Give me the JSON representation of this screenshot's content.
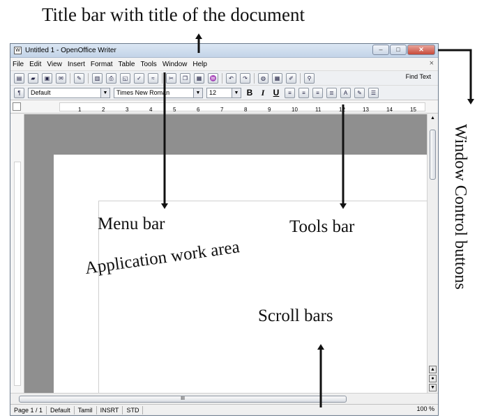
{
  "annotations": {
    "title_bar": "Title bar with title of the document",
    "menu_bar": "Menu bar",
    "tools_bar": "Tools bar",
    "work_area": "Application work area",
    "scroll_bars": "Scroll bars",
    "window_controls": "Window Control buttons"
  },
  "window": {
    "title": "Untitled 1 - OpenOffice Writer",
    "controls": [
      "–",
      "□",
      "✕"
    ]
  },
  "menu": {
    "items": [
      "File",
      "Edit",
      "View",
      "Insert",
      "Format",
      "Table",
      "Tools",
      "Window",
      "Help"
    ],
    "close_glyph": "×"
  },
  "toolbar": {
    "find_label": "Find Text"
  },
  "formatting": {
    "style": "Default",
    "font": "Times New Roman",
    "size": "12",
    "bold": "B",
    "italic": "I",
    "underline": "U"
  },
  "ruler": {
    "marks": [
      "1",
      "2",
      "3",
      "4",
      "5",
      "6",
      "7",
      "8",
      "9",
      "10",
      "11",
      "12",
      "13",
      "14",
      "15"
    ]
  },
  "status": {
    "page": "Page 1 / 1",
    "style": "Default",
    "language": "Tamil",
    "mode": "INSRT",
    "selection": "STD",
    "zoom": "100 %"
  },
  "scroll": {
    "hthumb_glyph": "III"
  }
}
